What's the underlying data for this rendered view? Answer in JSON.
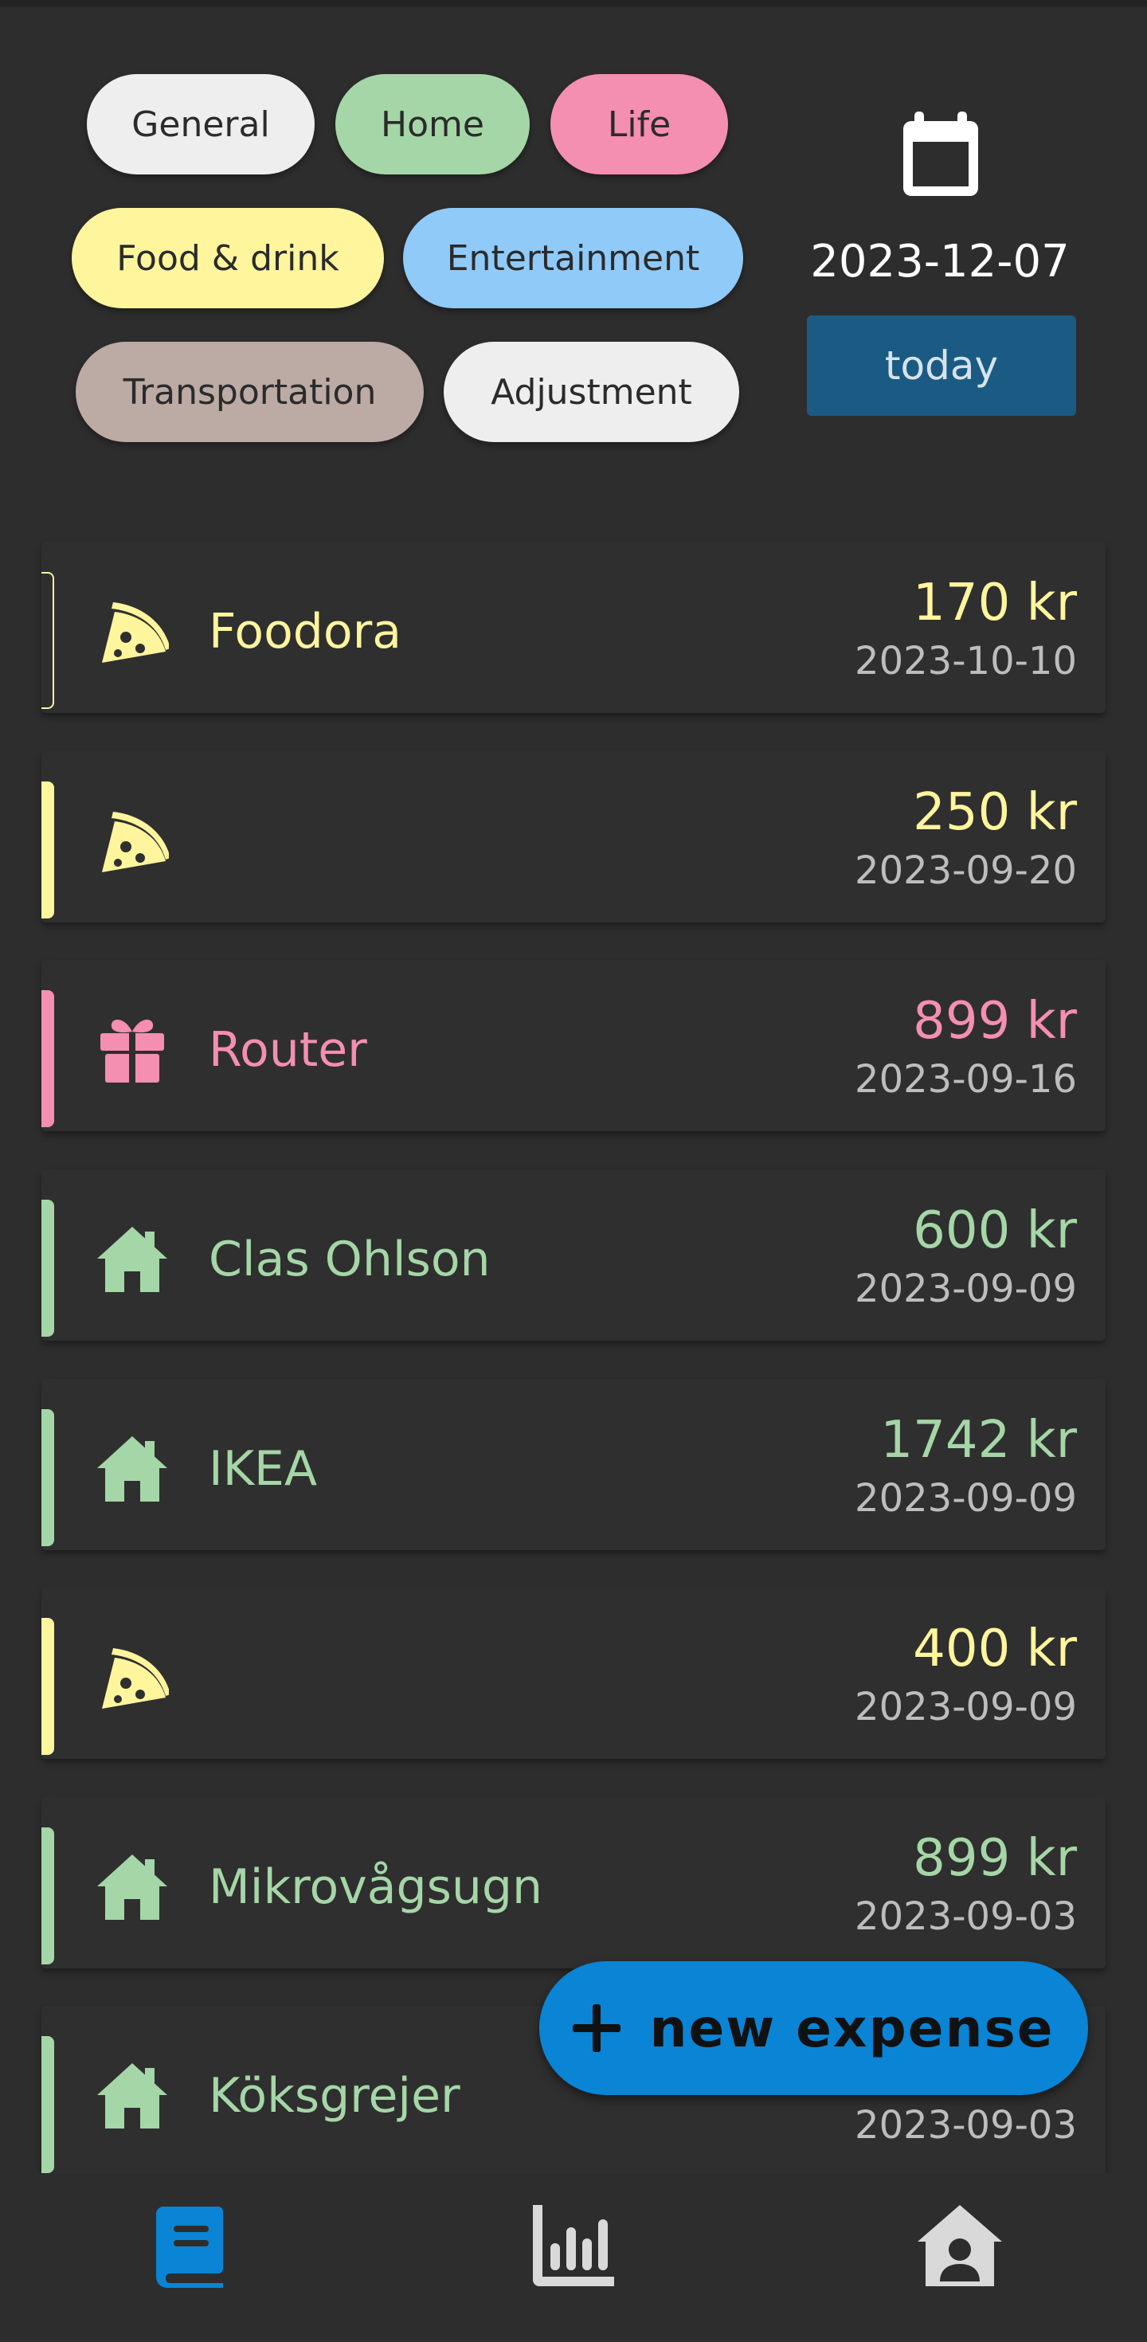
{
  "filters": {
    "chips": [
      {
        "label": "General",
        "color": "#eeeeee"
      },
      {
        "label": "Home",
        "color": "#a5d6a7"
      },
      {
        "label": "Life",
        "color": "#f48fb1"
      },
      {
        "label": "Food & drink",
        "color": "#fff59d"
      },
      {
        "label": "Entertainment",
        "color": "#90caf9"
      },
      {
        "label": "Transportation",
        "color": "#bcaaa4"
      },
      {
        "label": "Adjustment",
        "color": "#eeeeee"
      }
    ]
  },
  "date_picker": {
    "icon": "calendar-icon",
    "date": "2023-12-07",
    "today_label": "today"
  },
  "expenses": [
    {
      "name": "Foodora",
      "amount": "170 kr",
      "date": "2023-10-10",
      "category": "Food & drink",
      "icon": "pizza-icon",
      "color": "#fff59d"
    },
    {
      "name": "",
      "amount": "250 kr",
      "date": "2023-09-20",
      "category": "Food & drink",
      "icon": "pizza-icon",
      "color": "#fff59d"
    },
    {
      "name": "Router",
      "amount": "899 kr",
      "date": "2023-09-16",
      "category": "Life",
      "icon": "gift-icon",
      "color": "#f48fb1"
    },
    {
      "name": "Clas Ohlson",
      "amount": "600 kr",
      "date": "2023-09-09",
      "category": "Home",
      "icon": "home-icon",
      "color": "#a5d6a7"
    },
    {
      "name": "IKEA",
      "amount": "1742 kr",
      "date": "2023-09-09",
      "category": "Home",
      "icon": "home-icon",
      "color": "#a5d6a7"
    },
    {
      "name": "",
      "amount": "400 kr",
      "date": "2023-09-09",
      "category": "Food & drink",
      "icon": "pizza-icon",
      "color": "#fff59d"
    },
    {
      "name": "Mikrovågsugn",
      "amount": "899 kr",
      "date": "2023-09-03",
      "category": "Home",
      "icon": "home-icon",
      "color": "#a5d6a7"
    },
    {
      "name": "Köksgrejer",
      "amount": "",
      "date": "2023-09-03",
      "category": "Home",
      "icon": "home-icon",
      "color": "#a5d6a7"
    }
  ],
  "fab": {
    "label": "new expense",
    "icon": "plus-icon"
  },
  "bottom_nav": {
    "items": [
      {
        "icon": "book-icon",
        "active": true
      },
      {
        "icon": "bar-chart-icon",
        "active": false
      },
      {
        "icon": "account-home-icon",
        "active": false
      }
    ],
    "active_color": "#0a84d4",
    "inactive_color": "#d9d9d9"
  }
}
